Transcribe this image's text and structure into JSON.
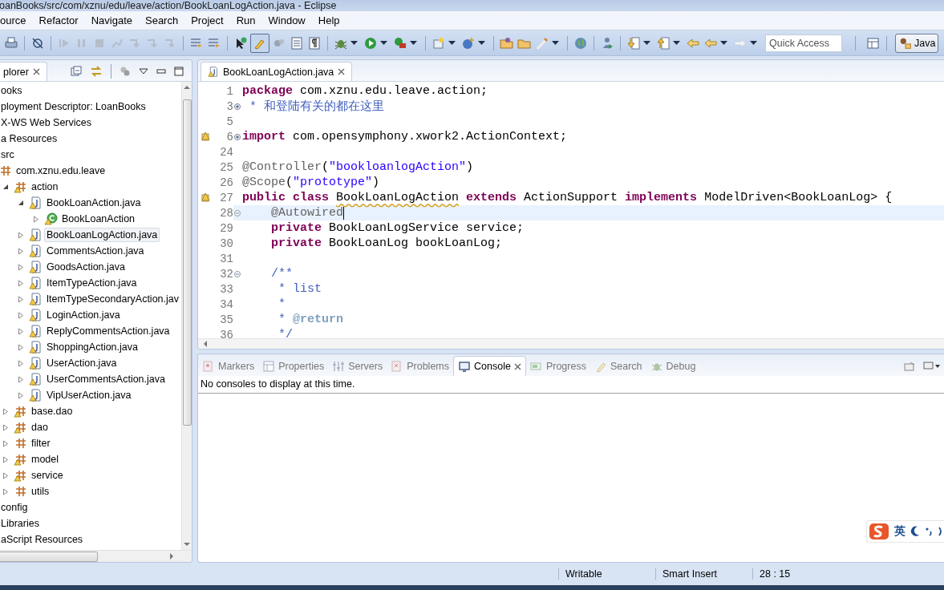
{
  "window": {
    "title": "oanBooks/src/com/xznu/edu/leave/action/BookLoanLogAction.java - Eclipse"
  },
  "menu": [
    "ource",
    "Refactor",
    "Navigate",
    "Search",
    "Project",
    "Run",
    "Window",
    "Help"
  ],
  "toolbar": {
    "quick_access": {
      "placeholder": "Quick Access"
    },
    "perspective": {
      "label": "Java",
      "selected": true
    }
  },
  "explorer": {
    "tab": {
      "label": "plorer"
    },
    "tree": [
      {
        "label": "ooks",
        "selected": false
      },
      {
        "label": "ployment Descriptor: LoanBooks",
        "selected": false
      },
      {
        "label": "X-WS Web Services",
        "selected": false
      },
      {
        "label": "a Resources",
        "selected": false
      },
      {
        "label": "src",
        "selected": false,
        "children": [
          {
            "label": "com.xznu.edu.leave",
            "kind": "package",
            "warning": false,
            "selected": false,
            "children": [
              {
                "label": "action",
                "kind": "package",
                "warning": true,
                "expanded": true,
                "selected": false,
                "children": [
                  {
                    "label": "BookLoanAction.java",
                    "kind": "file",
                    "warning": true,
                    "expanded": true,
                    "selected": false,
                    "children": [
                      {
                        "label": "BookLoanAction",
                        "kind": "class",
                        "warning": true,
                        "expanded": false,
                        "selected": false
                      }
                    ]
                  },
                  {
                    "label": "BookLoanLogAction.java",
                    "kind": "file",
                    "warning": true,
                    "expanded": false,
                    "selected": true
                  },
                  {
                    "label": "CommentsAction.java",
                    "kind": "file",
                    "warning": true,
                    "expanded": false,
                    "selected": false
                  },
                  {
                    "label": "GoodsAction.java",
                    "kind": "file",
                    "warning": true,
                    "expanded": false,
                    "selected": false
                  },
                  {
                    "label": "ItemTypeAction.java",
                    "kind": "file",
                    "warning": true,
                    "expanded": false,
                    "selected": false
                  },
                  {
                    "label": "ItemTypeSecondaryAction.jav",
                    "kind": "file",
                    "warning": true,
                    "expanded": false,
                    "selected": false
                  },
                  {
                    "label": "LoginAction.java",
                    "kind": "file",
                    "warning": true,
                    "expanded": false,
                    "selected": false
                  },
                  {
                    "label": "ReplyCommentsAction.java",
                    "kind": "file",
                    "warning": true,
                    "expanded": false,
                    "selected": false
                  },
                  {
                    "label": "ShoppingAction.java",
                    "kind": "file",
                    "warning": true,
                    "expanded": false,
                    "selected": false
                  },
                  {
                    "label": "UserAction.java",
                    "kind": "file",
                    "warning": true,
                    "expanded": false,
                    "selected": false
                  },
                  {
                    "label": "UserCommentsAction.java",
                    "kind": "file",
                    "warning": true,
                    "expanded": false,
                    "selected": false
                  },
                  {
                    "label": "VipUserAction.java",
                    "kind": "file",
                    "warning": true,
                    "expanded": false,
                    "selected": false
                  }
                ]
              },
              {
                "label": "base.dao",
                "kind": "package",
                "warning": true,
                "expanded": false,
                "selected": false
              },
              {
                "label": "dao",
                "kind": "package",
                "warning": true,
                "expanded": false,
                "selected": false
              },
              {
                "label": "filter",
                "kind": "package",
                "warning": false,
                "expanded": false,
                "selected": false
              },
              {
                "label": "model",
                "kind": "package",
                "warning": true,
                "expanded": false,
                "selected": false
              },
              {
                "label": "service",
                "kind": "package",
                "warning": true,
                "expanded": false,
                "selected": false
              },
              {
                "label": "utils",
                "kind": "package",
                "warning": false,
                "expanded": false,
                "selected": false
              }
            ]
          }
        ]
      },
      {
        "label": "config",
        "selected": false
      },
      {
        "label": "Libraries",
        "selected": false
      },
      {
        "label": "aScript Resources",
        "selected": false
      }
    ]
  },
  "editor": {
    "tab": {
      "label": "BookLoanLogAction.java",
      "warning": true
    },
    "lines": [
      {
        "number": "1",
        "current": false,
        "tokens": [
          {
            "kind": "keyword",
            "text": "package"
          },
          {
            "kind": "plain",
            "text": " com.xznu.edu.leave.action;"
          }
        ]
      },
      {
        "number": "3",
        "collapsed": true,
        "current": false,
        "tokens": [
          {
            "kind": "comment",
            "text": " * 和登陆有关的都在这里"
          }
        ]
      },
      {
        "number": "5",
        "current": false
      },
      {
        "number": "6",
        "collapsed": true,
        "warning": true,
        "current": false,
        "tokens": [
          {
            "kind": "keyword",
            "text": "import"
          },
          {
            "kind": "plain",
            "text": " com.opensymphony.xwork2.ActionContext;"
          }
        ]
      },
      {
        "number": "24",
        "current": false
      },
      {
        "number": "25",
        "current": false,
        "tokens": [
          {
            "kind": "annotation",
            "text": "@Controller"
          },
          {
            "kind": "plain",
            "text": "("
          },
          {
            "kind": "string",
            "text": "\"bookloanlogAction\""
          },
          {
            "kind": "plain",
            "text": ")"
          }
        ]
      },
      {
        "number": "26",
        "current": false,
        "tokens": [
          {
            "kind": "annotation",
            "text": "@Scope"
          },
          {
            "kind": "plain",
            "text": "("
          },
          {
            "kind": "string",
            "text": "\"prototype\""
          },
          {
            "kind": "plain",
            "text": ")"
          }
        ]
      },
      {
        "number": "27",
        "warning": true,
        "current": false,
        "tokens": [
          {
            "kind": "keyword",
            "text": "public class "
          },
          {
            "kind": "squiggle",
            "text": "BookLoanLogAction"
          },
          {
            "kind": "keyword",
            "text": " extends"
          },
          {
            "kind": "plain",
            "text": " ActionSupport "
          },
          {
            "kind": "keyword",
            "text": "implements"
          },
          {
            "kind": "plain",
            "text": " ModelDriven<BookLoanLog> {"
          }
        ]
      },
      {
        "number": "28",
        "collapsed": false,
        "current": true,
        "tokens": [
          {
            "kind": "annotation",
            "text": "    @Autowired"
          }
        ]
      },
      {
        "number": "29",
        "current": false,
        "tokens": [
          {
            "kind": "keyword",
            "text": "    private"
          },
          {
            "kind": "plain",
            "text": " BookLoanLogService service;"
          }
        ]
      },
      {
        "number": "30",
        "current": false,
        "tokens": [
          {
            "kind": "keyword",
            "text": "    private"
          },
          {
            "kind": "plain",
            "text": " BookLoanLog bookLoanLog;"
          }
        ]
      },
      {
        "number": "31",
        "current": false
      },
      {
        "number": "32",
        "collapsed": false,
        "current": false,
        "tokens": [
          {
            "kind": "comment",
            "text": "    /**"
          }
        ]
      },
      {
        "number": "33",
        "current": false,
        "tokens": [
          {
            "kind": "comment",
            "text": "     * list"
          }
        ]
      },
      {
        "number": "34",
        "current": false,
        "tokens": [
          {
            "kind": "comment",
            "text": "     *"
          }
        ]
      },
      {
        "number": "35",
        "current": false,
        "tokens": [
          {
            "kind": "comment",
            "text": "     * "
          },
          {
            "kind": "doctag",
            "text": "@return"
          }
        ]
      },
      {
        "number": "36",
        "current": false,
        "tokens": [
          {
            "kind": "comment",
            "text": "     */"
          }
        ]
      }
    ]
  },
  "console": {
    "tabs": [
      {
        "label": "Markers",
        "selected": false
      },
      {
        "label": "Properties",
        "selected": false
      },
      {
        "label": "Servers",
        "selected": false
      },
      {
        "label": "Problems",
        "selected": false
      },
      {
        "label": "Console",
        "selected": true
      },
      {
        "label": "Progress",
        "selected": false
      },
      {
        "label": "Search",
        "selected": false
      },
      {
        "label": "Debug",
        "selected": false
      }
    ],
    "message": "No consoles to display at this time."
  },
  "ime": {
    "label": "英"
  },
  "status_bar": [
    "Writable",
    "Smart Insert",
    "28 : 15"
  ]
}
